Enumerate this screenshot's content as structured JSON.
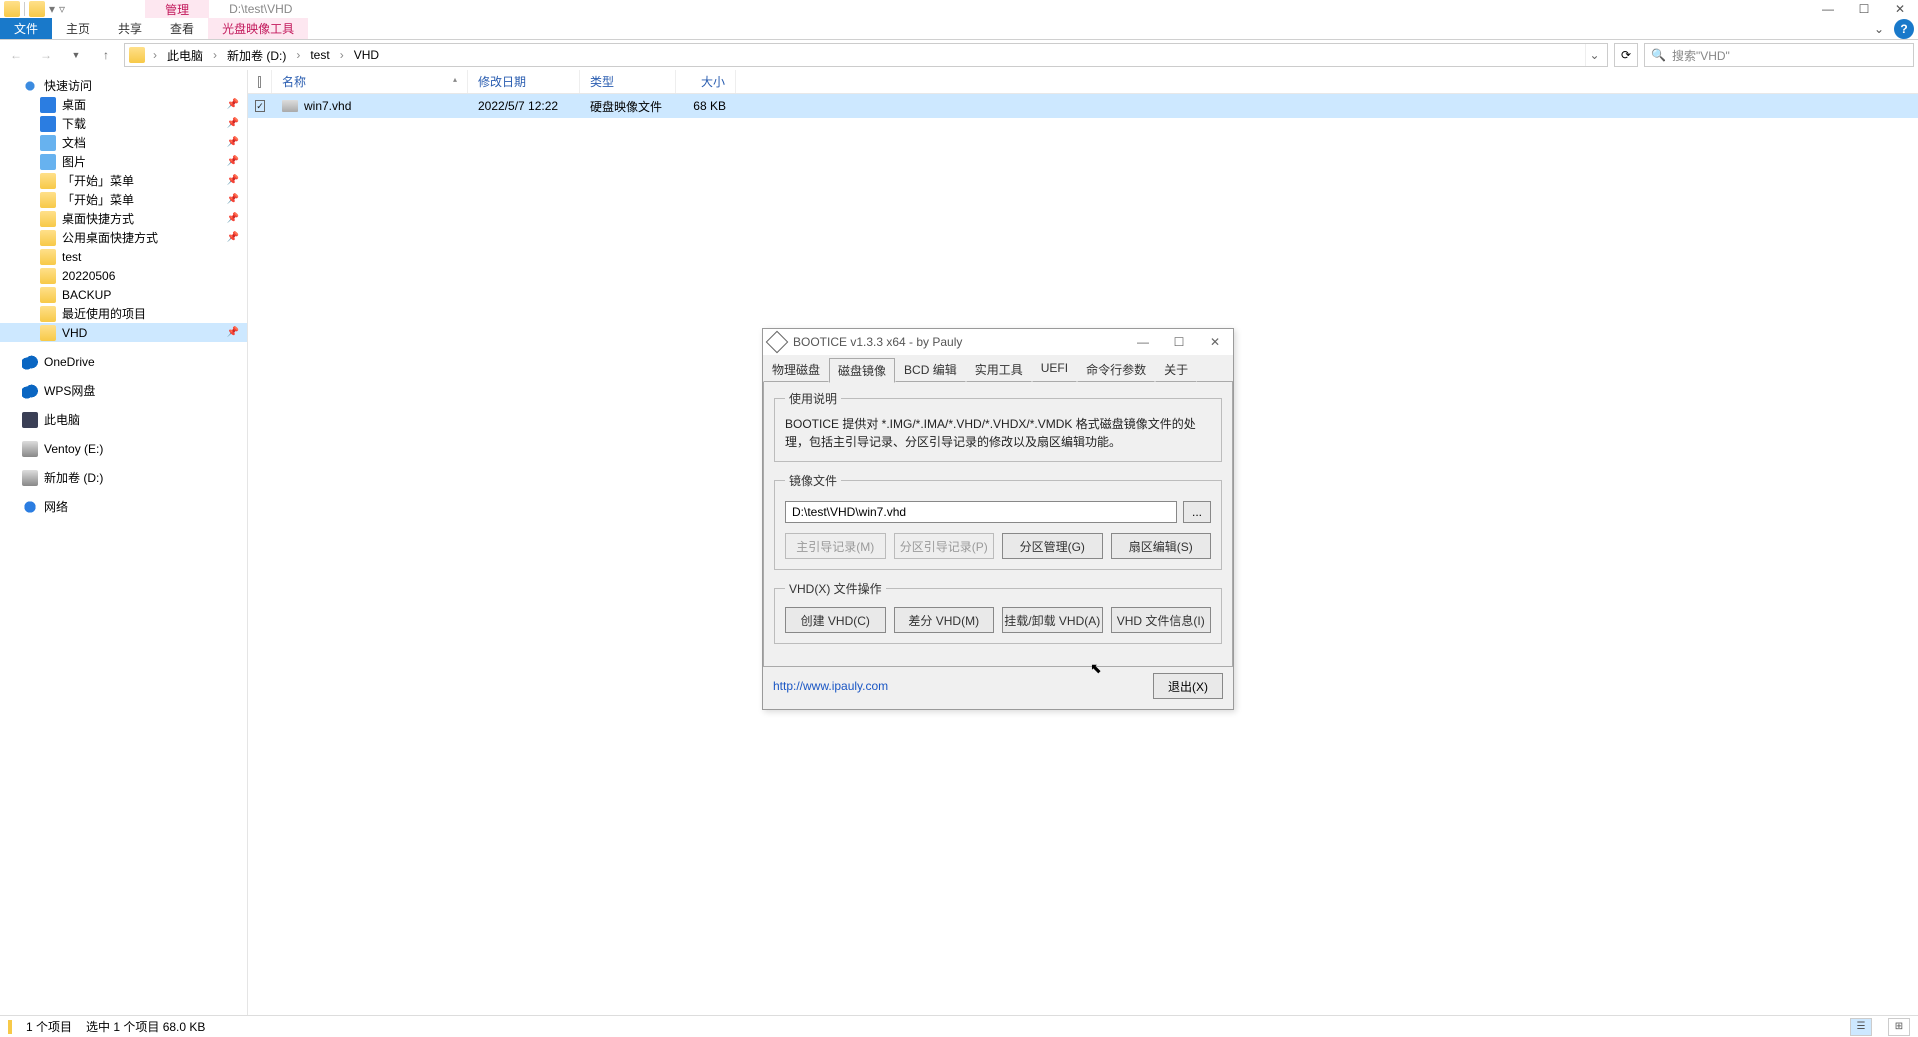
{
  "titlebar": {
    "contextual_label": "管理",
    "path": "D:\\test\\VHD"
  },
  "ribbon": {
    "file": "文件",
    "home": "主页",
    "share": "共享",
    "view": "查看",
    "ctx_tool": "光盘映像工具"
  },
  "nav": {
    "crumbs": [
      "此电脑",
      "新加卷 (D:)",
      "test",
      "VHD"
    ],
    "search_placeholder": "搜索\"VHD\""
  },
  "sidebar": {
    "quick_access": "快速访问",
    "items_qa": [
      {
        "label": "桌面",
        "ico": "desktop",
        "pin": true
      },
      {
        "label": "下载",
        "ico": "download",
        "pin": true
      },
      {
        "label": "文档",
        "ico": "doc",
        "pin": true
      },
      {
        "label": "图片",
        "ico": "pic",
        "pin": true
      },
      {
        "label": "「开始」菜单",
        "ico": "folder",
        "pin": true
      },
      {
        "label": "「开始」菜单",
        "ico": "folder",
        "pin": true
      },
      {
        "label": "桌面快捷方式",
        "ico": "folder",
        "pin": true
      },
      {
        "label": "公用桌面快捷方式",
        "ico": "folder",
        "pin": true
      },
      {
        "label": "test",
        "ico": "folder",
        "pin": false
      },
      {
        "label": "20220506",
        "ico": "folder",
        "pin": false
      },
      {
        "label": "BACKUP",
        "ico": "folder",
        "pin": false
      },
      {
        "label": "最近使用的项目",
        "ico": "folder",
        "pin": false
      },
      {
        "label": "VHD",
        "ico": "folder",
        "pin": true
      }
    ],
    "onedrive": "OneDrive",
    "wps": "WPS网盘",
    "thispc": "此电脑",
    "ventoy": "Ventoy (E:)",
    "newvol": "新加卷 (D:)",
    "network": "网络"
  },
  "filelist": {
    "cols": {
      "name": "名称",
      "date": "修改日期",
      "type": "类型",
      "size": "大小"
    },
    "rows": [
      {
        "name": "win7.vhd",
        "date": "2022/5/7 12:22",
        "type": "硬盘映像文件",
        "size": "68 KB"
      }
    ]
  },
  "status": {
    "count": "1 个项目",
    "selected": "选中 1 个项目 68.0 KB"
  },
  "dialog": {
    "title": "BOOTICE v1.3.3 x64 - by Pauly",
    "tabs": [
      "物理磁盘",
      "磁盘镜像",
      "BCD 编辑",
      "实用工具",
      "UEFI",
      "命令行参数",
      "关于"
    ],
    "active_tab": 1,
    "section_usage": "使用说明",
    "usage_text": "BOOTICE 提供对 *.IMG/*.IMA/*.VHD/*.VHDX/*.VMDK 格式磁盘镜像文件的处理，包括主引导记录、分区引导记录的修改以及扇区编辑功能。",
    "section_file": "镜像文件",
    "file_path": "D:\\test\\VHD\\win7.vhd",
    "btn_mbr": "主引导记录(M)",
    "btn_pbr": "分区引导记录(P)",
    "btn_part": "分区管理(G)",
    "btn_sector": "扇区编辑(S)",
    "section_vhd": "VHD(X) 文件操作",
    "btn_create": "创建 VHD(C)",
    "btn_diff": "差分 VHD(M)",
    "btn_mount": "挂载/卸载 VHD(A)",
    "btn_info": "VHD 文件信息(I)",
    "url": "http://www.ipauly.com",
    "exit": "退出(X)"
  }
}
